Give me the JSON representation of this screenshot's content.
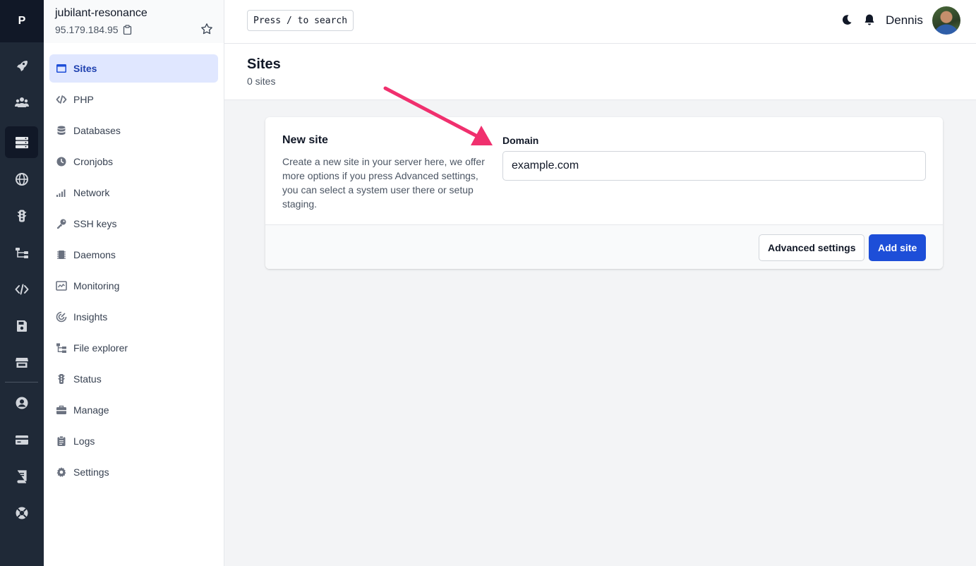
{
  "rail": {
    "logo": "P",
    "items": [
      {
        "icon": "rocket-icon"
      },
      {
        "icon": "users-icon"
      },
      {
        "icon": "servers-icon",
        "active": true
      },
      {
        "icon": "globe-icon"
      },
      {
        "icon": "traffic-light-icon"
      },
      {
        "icon": "network-tree-icon"
      },
      {
        "icon": "code-icon"
      },
      {
        "icon": "floppy-disk-icon"
      },
      {
        "icon": "store-icon"
      },
      {
        "icon": "user-circle-icon"
      },
      {
        "icon": "credit-card-icon"
      },
      {
        "icon": "book-icon"
      },
      {
        "icon": "life-ring-icon"
      }
    ]
  },
  "server": {
    "name": "jubilant-resonance",
    "ip": "95.179.184.95",
    "copy_icon": "clipboard-icon",
    "favorite_icon": "star-icon"
  },
  "nav": {
    "items": [
      {
        "label": "Sites",
        "icon": "browser-window-icon",
        "active": true
      },
      {
        "label": "PHP",
        "icon": "code-icon"
      },
      {
        "label": "Databases",
        "icon": "database-icon"
      },
      {
        "label": "Cronjobs",
        "icon": "clock-icon"
      },
      {
        "label": "Network",
        "icon": "signal-bars-icon"
      },
      {
        "label": "SSH keys",
        "icon": "key-icon"
      },
      {
        "label": "Daemons",
        "icon": "chip-icon"
      },
      {
        "label": "Monitoring",
        "icon": "monitor-chart-icon"
      },
      {
        "label": "Insights",
        "icon": "radar-icon"
      },
      {
        "label": "File explorer",
        "icon": "folder-tree-icon"
      },
      {
        "label": "Status",
        "icon": "traffic-light-icon"
      },
      {
        "label": "Manage",
        "icon": "toolbox-icon"
      },
      {
        "label": "Logs",
        "icon": "clipboard-list-icon"
      },
      {
        "label": "Settings",
        "icon": "gear-icon"
      }
    ]
  },
  "topbar": {
    "search_hint": "Press / to search",
    "theme_icon": "moon-icon",
    "notifications_icon": "bell-icon",
    "user_name": "Dennis"
  },
  "page": {
    "title": "Sites",
    "subtitle": "0 sites"
  },
  "new_site": {
    "title": "New site",
    "description": "Create a new site in your server here, we offer more options if you press Advanced settings, you can select a system user there or setup staging.",
    "domain_label": "Domain",
    "domain_value": "example.com",
    "advanced_label": "Advanced settings",
    "add_label": "Add site"
  },
  "colors": {
    "rail_bg": "#1f2937",
    "accent": "#1d4ed8",
    "active_nav_bg": "#e0e7ff",
    "annotation_arrow": "#f0306e"
  }
}
